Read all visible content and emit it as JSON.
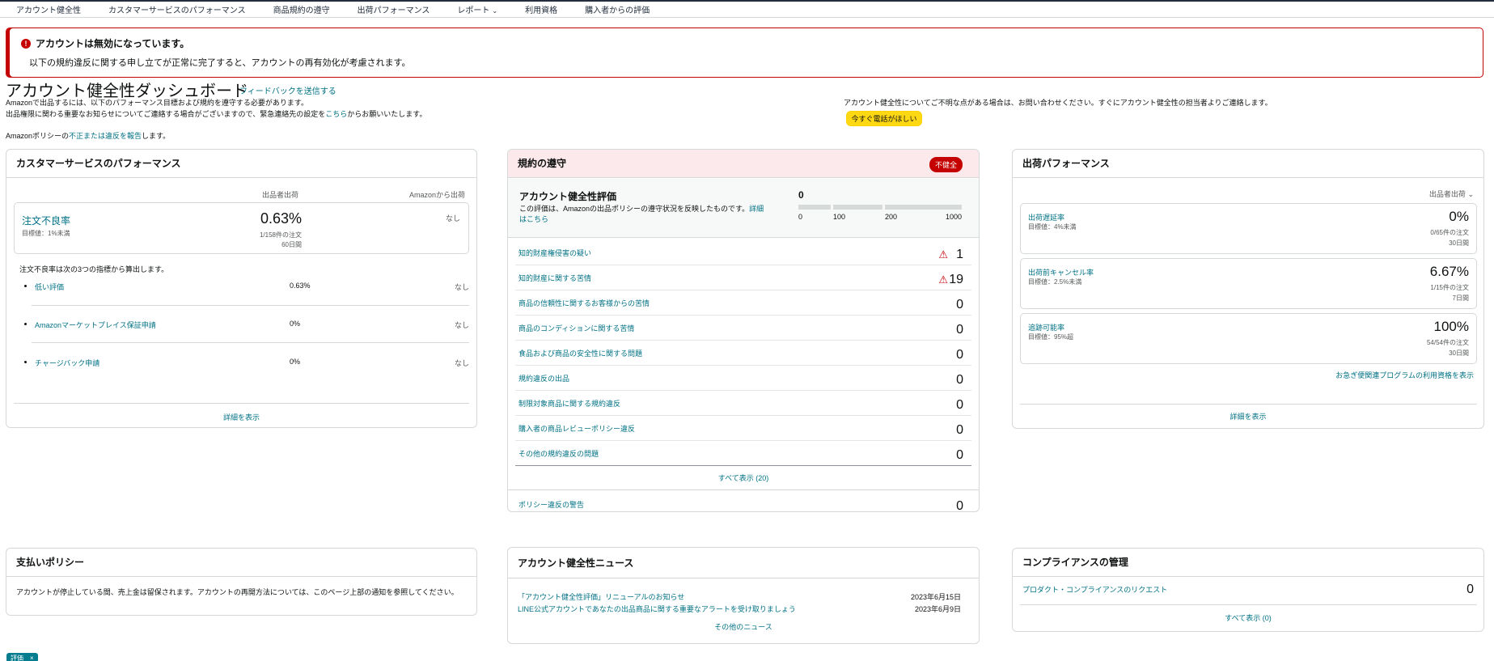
{
  "nav": {
    "items": [
      "アカウント健全性",
      "カスタマーサービスのパフォーマンス",
      "商品規約の遵守",
      "出荷パフォーマンス",
      "レポート",
      "利用資格",
      "購入者からの評価"
    ]
  },
  "alert": {
    "title": "アカウントは無効になっています。",
    "body": "以下の規約違反に関する申し立てが正常に完了すると、アカウントの再有効化が考慮されます。"
  },
  "header": {
    "title": "アカウント健全性ダッシュボード",
    "feedback": "フィードバックを送信する",
    "intro1": "Amazonで出品するには、以下のパフォーマンス目標および規約を遵守する必要があります。",
    "intro2_pre": "出品権限に関わる重要なお知らせについてご連絡する場合がございますので、緊急連絡先の設定を",
    "intro2_link": "こちら",
    "intro2_post": "からお願いいたします。",
    "report_pre": "Amazonポリシーの",
    "report_link": "不正または違反を報告",
    "report_post": "します。",
    "contact": "アカウント健全性についてご不明な点がある場合は、お問い合わせください。すぐにアカウント健全性の担当者よりご連絡します。",
    "call_button": "今すぐ電話がほしい"
  },
  "customer": {
    "title": "カスタマーサービスのパフォーマンス",
    "col_seller": "出品者出荷",
    "col_fba": "Amazonから出荷",
    "odr": {
      "name": "注文不良率",
      "target": "目標値：1%未満",
      "value": "0.63%",
      "count": "1/158件の注文",
      "period": "60日間",
      "fba": "なし"
    },
    "calc_note": "注文不良率は次の3つの指標から算出します。",
    "subs": [
      {
        "name": "低い評価",
        "value": "0.63%",
        "fba": "なし"
      },
      {
        "name": "Amazonマーケットプレイス保証申請",
        "value": "0%",
        "fba": "なし"
      },
      {
        "name": "チャージバック申請",
        "value": "0%",
        "fba": "なし"
      }
    ],
    "details": "詳細を表示"
  },
  "policy": {
    "title": "規約の遵守",
    "badge": "不健全",
    "ahr_title": "アカウント健全性評価",
    "ahr_desc_pre": "この評価は、Amazonの出品ポリシーの遵守状況を反映したものです。",
    "ahr_desc_link": "詳細はこちら",
    "ahr_score": "0",
    "ahr_ticks": [
      "0",
      "100",
      "200",
      "1000"
    ],
    "violations": [
      {
        "label": "知的財産権侵害の疑い",
        "count": "1",
        "warn": true
      },
      {
        "label": "知的財産に関する苦情",
        "count": "19",
        "warn": true
      },
      {
        "label": "商品の信頼性に関するお客様からの苦情",
        "count": "0",
        "warn": false
      },
      {
        "label": "商品のコンディションに関する苦情",
        "count": "0",
        "warn": false
      },
      {
        "label": "食品および商品の安全性に関する問題",
        "count": "0",
        "warn": false
      },
      {
        "label": "規約違反の出品",
        "count": "0",
        "warn": false
      },
      {
        "label": "制限対象商品に関する規約違反",
        "count": "0",
        "warn": false
      },
      {
        "label": "購入者の商品レビューポリシー違反",
        "count": "0",
        "warn": false
      },
      {
        "label": "その他の規約違反の問題",
        "count": "0",
        "warn": false
      }
    ],
    "show_all": "すべて表示 (20)",
    "warning_label": "ポリシー違反の警告",
    "warning_count": "0"
  },
  "shipping": {
    "title": "出荷パフォーマンス",
    "filter": "出品者出荷",
    "metrics": [
      {
        "name": "出荷遅延率",
        "target": "目標値：4%未満",
        "value": "0%",
        "count": "0/65件の注文",
        "period": "30日間"
      },
      {
        "name": "出荷前キャンセル率",
        "target": "目標値：2.5%未満",
        "value": "6.67%",
        "count": "1/15件の注文",
        "period": "7日間"
      },
      {
        "name": "追跡可能率",
        "target": "目標値：95%超",
        "value": "100%",
        "count": "54/54件の注文",
        "period": "30日間"
      }
    ],
    "fast_program": "お急ぎ便関連プログラムの利用資格を表示",
    "details": "詳細を表示"
  },
  "payment": {
    "title": "支払いポリシー",
    "text": "アカウントが停止している間、売上金は留保されます。アカウントの再開方法については、このページ上部の通知を参照してください。"
  },
  "news": {
    "title": "アカウント健全性ニュース",
    "items": [
      {
        "title": "「アカウント健全性評価」リニューアルのお知らせ",
        "date": "2023年6月15日"
      },
      {
        "title": "LINE公式アカウントであなたの出品商品に関する重要なアラートを受け取りましょう",
        "date": "2023年6月9日"
      }
    ],
    "more": "その他のニュース"
  },
  "compliance": {
    "title": "コンプライアンスの管理",
    "label": "プロダクト・コンプライアンスのリクエスト",
    "count": "0",
    "show_all": "すべて表示 (0)"
  },
  "chip": {
    "label": "評価",
    "close": "×"
  },
  "colors": {
    "accent": "#007185",
    "danger": "#c40000",
    "button": "#ffd814",
    "tint": "#fce9eb"
  },
  "icons": [
    "error-circle-icon",
    "warning-triangle-icon",
    "chevron-down-icon",
    "close-icon"
  ]
}
